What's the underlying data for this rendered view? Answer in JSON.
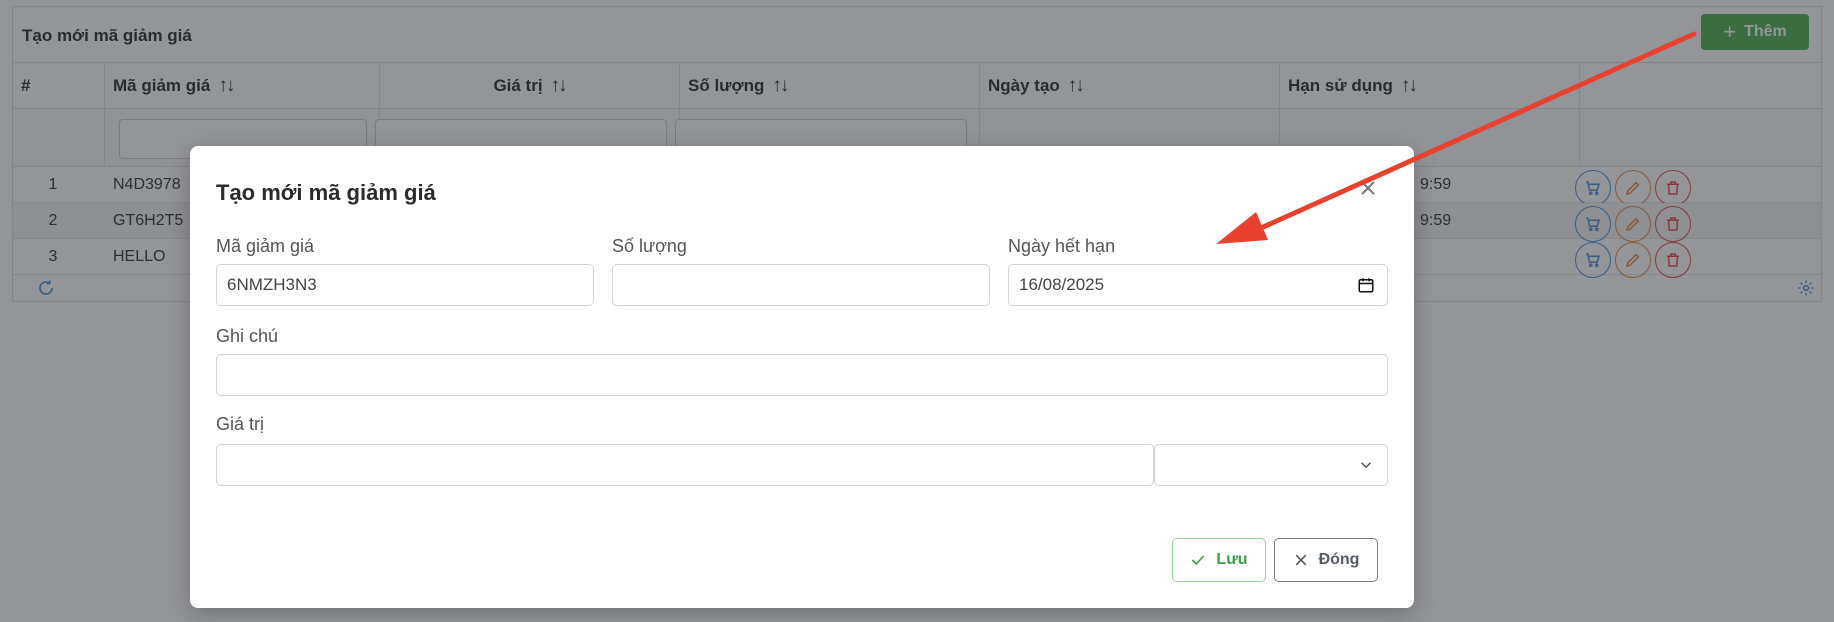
{
  "page": {
    "title": "Tạo mới mã giảm giá",
    "add_button_label": "Thêm",
    "columns": [
      {
        "label": "#",
        "sortable": false
      },
      {
        "label": "Mã giảm giá",
        "sortable": true
      },
      {
        "label": "Giá trị",
        "sortable": true
      },
      {
        "label": "Số lượng",
        "sortable": true
      },
      {
        "label": "Ngày tạo",
        "sortable": true
      },
      {
        "label": "Hạn sử dụng",
        "sortable": true
      }
    ],
    "sort_icon": "↑↓",
    "rows": [
      {
        "index": "1",
        "code": "N4D3978",
        "expiry_tail": "9:59"
      },
      {
        "index": "2",
        "code": "GT6H2T5",
        "expiry_tail": "9:59"
      },
      {
        "index": "3",
        "code": "HELLO",
        "expiry_tail": ""
      }
    ],
    "row_action_icons": [
      "cart-icon",
      "pencil-icon",
      "trash-icon"
    ],
    "footer_icons": [
      "refresh-icon",
      "gear-icon"
    ]
  },
  "modal": {
    "title": "Tạo mới mã giảm giá",
    "fields": {
      "code": {
        "label": "Mã giảm giá",
        "value": "6NMZH3N3"
      },
      "quantity": {
        "label": "Số lượng",
        "value": ""
      },
      "expiry": {
        "label": "Ngày hết hạn",
        "value": "16/08/2025"
      },
      "note": {
        "label": "Ghi chú",
        "value": ""
      },
      "amount": {
        "label": "Giá trị",
        "value": "",
        "unit_value": ""
      }
    },
    "save_label": "Lưu",
    "close_label": "Đóng"
  },
  "colors": {
    "primary_green": "#4caf50",
    "info_blue": "#4a90d9",
    "warning_orange": "#e8863a",
    "danger_red": "#e24a3a",
    "arrow_red": "#e8412f"
  }
}
